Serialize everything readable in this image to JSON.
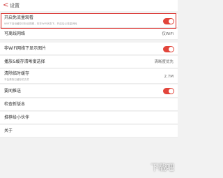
{
  "header": {
    "back_glyph": "<",
    "title": "设置"
  },
  "settings": [
    {
      "label": "开启免流量观看",
      "sub": "WiFi下自动缓存已标记视频，在非WiFi状态下，开启后以流量消耗",
      "control": "toggle",
      "on": true
    },
    {
      "label": "可离线网络",
      "value": "仅WiFi",
      "control": "value"
    },
    {
      "label": "非WiFi网络下显示图片",
      "control": "toggle",
      "on": true
    },
    {
      "label": "播放&缓存清晰度选择",
      "value": "清晰度优先",
      "control": "value"
    },
    {
      "label": "清除临时缓存",
      "sub": "不会清除已缓存的文件",
      "value": "2.7M",
      "control": "value"
    },
    {
      "label": "要闻推送",
      "control": "toggle",
      "on": true
    },
    {
      "label": "检查新版本",
      "control": "none"
    },
    {
      "label": "推荐给小伙伴",
      "control": "none"
    },
    {
      "label": "关于",
      "control": "none"
    }
  ],
  "watermark": {
    "text": "下载吧"
  },
  "colors": {
    "accent": "#e2453b",
    "highlight_border": "#d8231f",
    "background": "#f2f2f2"
  }
}
